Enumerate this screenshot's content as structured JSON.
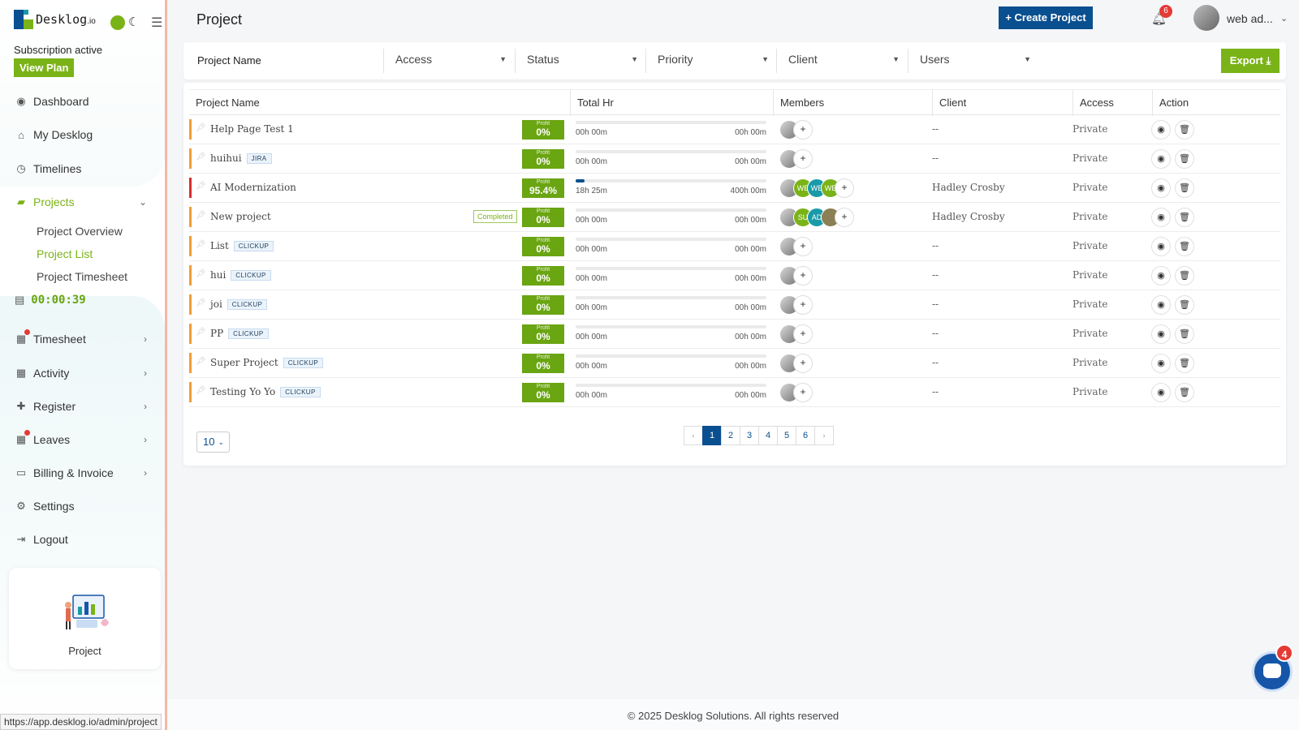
{
  "brand": {
    "name": "Desk",
    "name2": "log",
    "suffix": ".io"
  },
  "sidebar": {
    "subscription": "Subscription active",
    "view_plan": "View Plan",
    "items": [
      {
        "label": "Dashboard",
        "icon": "dashboard-icon"
      },
      {
        "label": "My Desklog",
        "icon": "home-icon"
      },
      {
        "label": "Timelines",
        "icon": "clock-icon"
      },
      {
        "label": "Projects",
        "icon": "folder-icon"
      },
      {
        "label": "Timesheet",
        "icon": "sheet-icon"
      },
      {
        "label": "Activity",
        "icon": "grid-icon"
      },
      {
        "label": "Register",
        "icon": "plus-icon"
      },
      {
        "label": "Leaves",
        "icon": "calendar-icon"
      },
      {
        "label": "Billing & Invoice",
        "icon": "invoice-icon"
      },
      {
        "label": "Settings",
        "icon": "gear-icon"
      },
      {
        "label": "Logout",
        "icon": "logout-icon"
      }
    ],
    "projects_sub": [
      "Project Overview",
      "Project List",
      "Project Timesheet"
    ],
    "timer": "00:00:39",
    "promo_label": "Project",
    "status_url": "https://app.desklog.io/admin/project"
  },
  "header": {
    "title": "Project",
    "create_button": "+ Create Project",
    "notifications_count": "6",
    "user_name": "web ad..."
  },
  "filters": {
    "name_label": "Project Name",
    "selects": [
      "Access",
      "Status",
      "Priority",
      "Client",
      "Users"
    ],
    "export_label": "Export"
  },
  "table": {
    "columns": [
      "Project Name",
      "Total Hr",
      "Members",
      "Client",
      "Access",
      "Action"
    ],
    "profit_label": "Profit",
    "completed_label": "Completed",
    "rows": [
      {
        "name": "Help Page Test 1",
        "tag": "",
        "status": "",
        "profit": "0%",
        "logged": "00h 00m",
        "estimated": "00h 00m",
        "progress": 0,
        "members": [],
        "client": "--",
        "access": "Private",
        "bar": "orange"
      },
      {
        "name": "huihui",
        "tag": "JIRA",
        "status": "",
        "profit": "0%",
        "logged": "00h 00m",
        "estimated": "00h 00m",
        "progress": 0,
        "members": [],
        "client": "--",
        "access": "Private",
        "bar": "orange"
      },
      {
        "name": "AI Modernization",
        "tag": "",
        "status": "",
        "profit": "95.4%",
        "logged": "18h 25m",
        "estimated": "400h 00m",
        "progress": 0.046,
        "members": [
          {
            "i": "WE",
            "c": "#7ab317"
          },
          {
            "i": "WE",
            "c": "#1a9aa8"
          },
          {
            "i": "WE",
            "c": "#7ab317"
          }
        ],
        "client": "Hadley Crosby",
        "access": "Private",
        "bar": "red"
      },
      {
        "name": "New project",
        "tag": "",
        "status": "Completed",
        "profit": "0%",
        "logged": "00h 00m",
        "estimated": "00h 00m",
        "progress": 0,
        "members": [
          {
            "i": "SU",
            "c": "#7ab317"
          },
          {
            "i": "AD",
            "c": "#1a9aa8"
          },
          {
            "i": "",
            "c": "#8a7f55"
          }
        ],
        "client": "Hadley Crosby",
        "access": "Private",
        "bar": "orange"
      },
      {
        "name": "List",
        "tag": "CLICKUP",
        "status": "",
        "profit": "0%",
        "logged": "00h 00m",
        "estimated": "00h 00m",
        "progress": 0,
        "members": [],
        "client": "--",
        "access": "Private",
        "bar": "orange"
      },
      {
        "name": "hui",
        "tag": "CLICKUP",
        "status": "",
        "profit": "0%",
        "logged": "00h 00m",
        "estimated": "00h 00m",
        "progress": 0,
        "members": [],
        "client": "--",
        "access": "Private",
        "bar": "orange"
      },
      {
        "name": "joi",
        "tag": "CLICKUP",
        "status": "",
        "profit": "0%",
        "logged": "00h 00m",
        "estimated": "00h 00m",
        "progress": 0,
        "members": [],
        "client": "--",
        "access": "Private",
        "bar": "orange"
      },
      {
        "name": "PP",
        "tag": "CLICKUP",
        "status": "",
        "profit": "0%",
        "logged": "00h 00m",
        "estimated": "00h 00m",
        "progress": 0,
        "members": [],
        "client": "--",
        "access": "Private",
        "bar": "orange"
      },
      {
        "name": "Super Project",
        "tag": "CLICKUP",
        "status": "",
        "profit": "0%",
        "logged": "00h 00m",
        "estimated": "00h 00m",
        "progress": 0,
        "members": [],
        "client": "--",
        "access": "Private",
        "bar": "orange"
      },
      {
        "name": "Testing Yo Yo",
        "tag": "CLICKUP",
        "status": "",
        "profit": "0%",
        "logged": "00h 00m",
        "estimated": "00h 00m",
        "progress": 0,
        "members": [],
        "client": "--",
        "access": "Private",
        "bar": "orange"
      }
    ]
  },
  "pagination": {
    "per_page": "10",
    "pages": [
      "1",
      "2",
      "3",
      "4",
      "5",
      "6"
    ],
    "current": "1",
    "prev": "‹",
    "next": "›"
  },
  "footer": "© 2025 Desklog Solutions. All rights reserved",
  "chat": {
    "count": "4"
  },
  "colors": {
    "brand_green": "#7ab317",
    "brand_blue": "#0a4f8f",
    "alert_red": "#e53935"
  }
}
